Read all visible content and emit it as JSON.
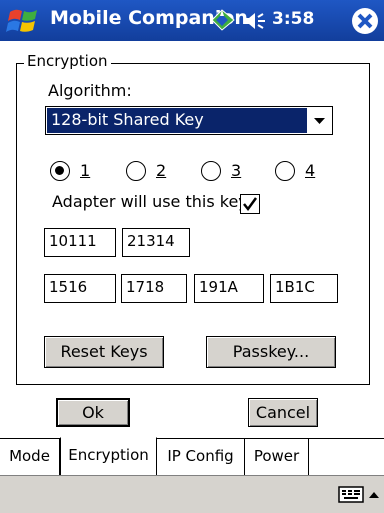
{
  "app": {
    "title": "Mobile Companion",
    "time": "3:58"
  },
  "group": {
    "legend": "Encryption"
  },
  "algorithm": {
    "label": "Algorithm:",
    "selected": "128-bit Shared Key"
  },
  "key_radios": [
    {
      "label": "1",
      "selected": true
    },
    {
      "label": "2",
      "selected": false
    },
    {
      "label": "3",
      "selected": false
    },
    {
      "label": "4",
      "selected": false
    }
  ],
  "adapter_checkbox": {
    "label": "Adapter will use this key",
    "checked": true
  },
  "keys": {
    "row1": [
      "10111",
      "21314"
    ],
    "row2": [
      "1516",
      "1718",
      "191A",
      "1B1C"
    ]
  },
  "buttons": {
    "reset_keys": "Reset Keys",
    "passkey": "Passkey...",
    "ok": "Ok",
    "cancel": "Cancel"
  },
  "tabs": [
    {
      "label": "Mode",
      "active": false
    },
    {
      "label": "Encryption",
      "active": true
    },
    {
      "label": "IP Config",
      "active": false
    },
    {
      "label": "Power",
      "active": false
    }
  ],
  "colors": {
    "titlebar": "#1f57c4",
    "selection": "#0a246a",
    "button_face": "#d6d3ce"
  },
  "icons": [
    "windows-start-icon",
    "connectivity-icon",
    "speaker-icon",
    "close-icon",
    "keyboard-icon",
    "sip-arrow-icon"
  ]
}
